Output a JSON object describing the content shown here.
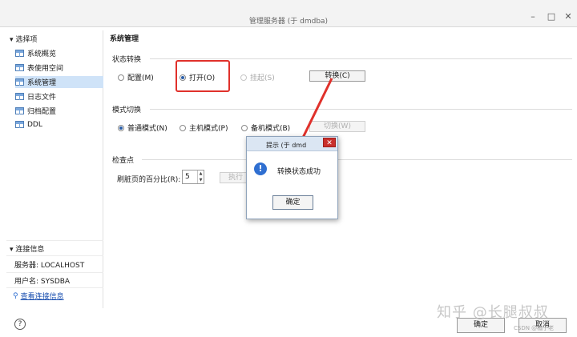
{
  "window": {
    "title": "管理服务器 (于 dmdba)"
  },
  "sidebar": {
    "section_header": "选择项",
    "items": [
      {
        "label": "系统概览"
      },
      {
        "label": "表使用空间"
      },
      {
        "label": "系统管理"
      },
      {
        "label": "日志文件"
      },
      {
        "label": "归档配置"
      },
      {
        "label": "DDL"
      }
    ],
    "connection_header": "连接信息",
    "server": "服务器: LOCALHOST",
    "user": "用户名: SYSDBA",
    "view_link": "查看连接信息"
  },
  "main": {
    "title": "系统管理",
    "state_group": {
      "label": "状态转换",
      "options": [
        "配置(M)",
        "打开(O)",
        "挂起(S)"
      ],
      "selected": "打开(O)",
      "button": "转换(C)"
    },
    "mode_group": {
      "label": "模式切换",
      "options": [
        "普通模式(N)",
        "主机模式(P)",
        "备机模式(B)"
      ],
      "selected": "普通模式(N)",
      "button": "切换(W)"
    },
    "checkpoint_group": {
      "label": "检查点",
      "field_label": "刷脏页的百分比(R):",
      "field_value": "5",
      "button": "执行"
    }
  },
  "dialog": {
    "title": "提示  (于 dmd",
    "message": "转换状态成功",
    "ok_button": "确定"
  },
  "footer": {
    "ok_button": "确定",
    "cancel_button": "取消",
    "help": "?"
  },
  "watermark": {
    "main": "知乎 @长腿叔叔",
    "sub": "CSDN @橘子老"
  },
  "colors": {
    "highlight": "#e0312b",
    "accent": "#2f6fd1",
    "selection": "#cfe3f8"
  }
}
